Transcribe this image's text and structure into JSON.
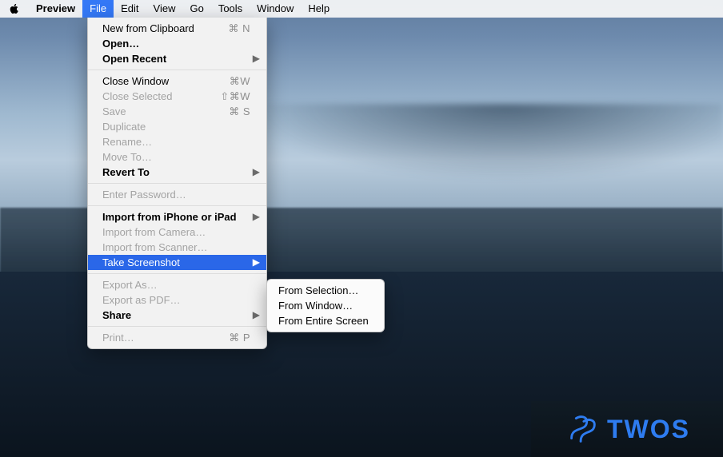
{
  "menubar": {
    "app": "Preview",
    "items": [
      "File",
      "Edit",
      "View",
      "Go",
      "Tools",
      "Window",
      "Help"
    ],
    "open_index": 0
  },
  "file_menu": {
    "groups": [
      [
        {
          "label": "New from Clipboard",
          "shortcut": "⌘ N",
          "enabled": true,
          "submenu": false
        },
        {
          "label": "Open…",
          "shortcut": "",
          "enabled": true,
          "submenu": false,
          "bold": true
        },
        {
          "label": "Open Recent",
          "shortcut": "",
          "enabled": true,
          "submenu": true,
          "bold": true
        }
      ],
      [
        {
          "label": "Close Window",
          "shortcut": "⌘W",
          "enabled": true,
          "submenu": false
        },
        {
          "label": "Close Selected",
          "shortcut": "⇧⌘W",
          "enabled": false,
          "submenu": false
        },
        {
          "label": "Save",
          "shortcut": "⌘ S",
          "enabled": false,
          "submenu": false
        },
        {
          "label": "Duplicate",
          "shortcut": "",
          "enabled": false,
          "submenu": false
        },
        {
          "label": "Rename…",
          "shortcut": "",
          "enabled": false,
          "submenu": false
        },
        {
          "label": "Move To…",
          "shortcut": "",
          "enabled": false,
          "submenu": false
        },
        {
          "label": "Revert To",
          "shortcut": "",
          "enabled": true,
          "submenu": true,
          "bold": true
        }
      ],
      [
        {
          "label": "Enter Password…",
          "shortcut": "",
          "enabled": false,
          "submenu": false
        }
      ],
      [
        {
          "label": "Import from iPhone or iPad",
          "shortcut": "",
          "enabled": true,
          "submenu": true,
          "bold": true
        },
        {
          "label": "Import from Camera…",
          "shortcut": "",
          "enabled": false,
          "submenu": false
        },
        {
          "label": "Import from Scanner…",
          "shortcut": "",
          "enabled": false,
          "submenu": false
        },
        {
          "label": "Take Screenshot",
          "shortcut": "",
          "enabled": true,
          "submenu": true,
          "highlight": true
        }
      ],
      [
        {
          "label": "Export As…",
          "shortcut": "",
          "enabled": false,
          "submenu": false
        },
        {
          "label": "Export as PDF…",
          "shortcut": "",
          "enabled": false,
          "submenu": false
        },
        {
          "label": "Share",
          "shortcut": "",
          "enabled": true,
          "submenu": true,
          "bold": true
        }
      ],
      [
        {
          "label": "Print…",
          "shortcut": "⌘ P",
          "enabled": false,
          "submenu": false
        }
      ]
    ]
  },
  "submenu_take_screenshot": [
    "From Selection…",
    "From Window…",
    "From Entire Screen"
  ],
  "watermark": {
    "text": "TWOS"
  }
}
